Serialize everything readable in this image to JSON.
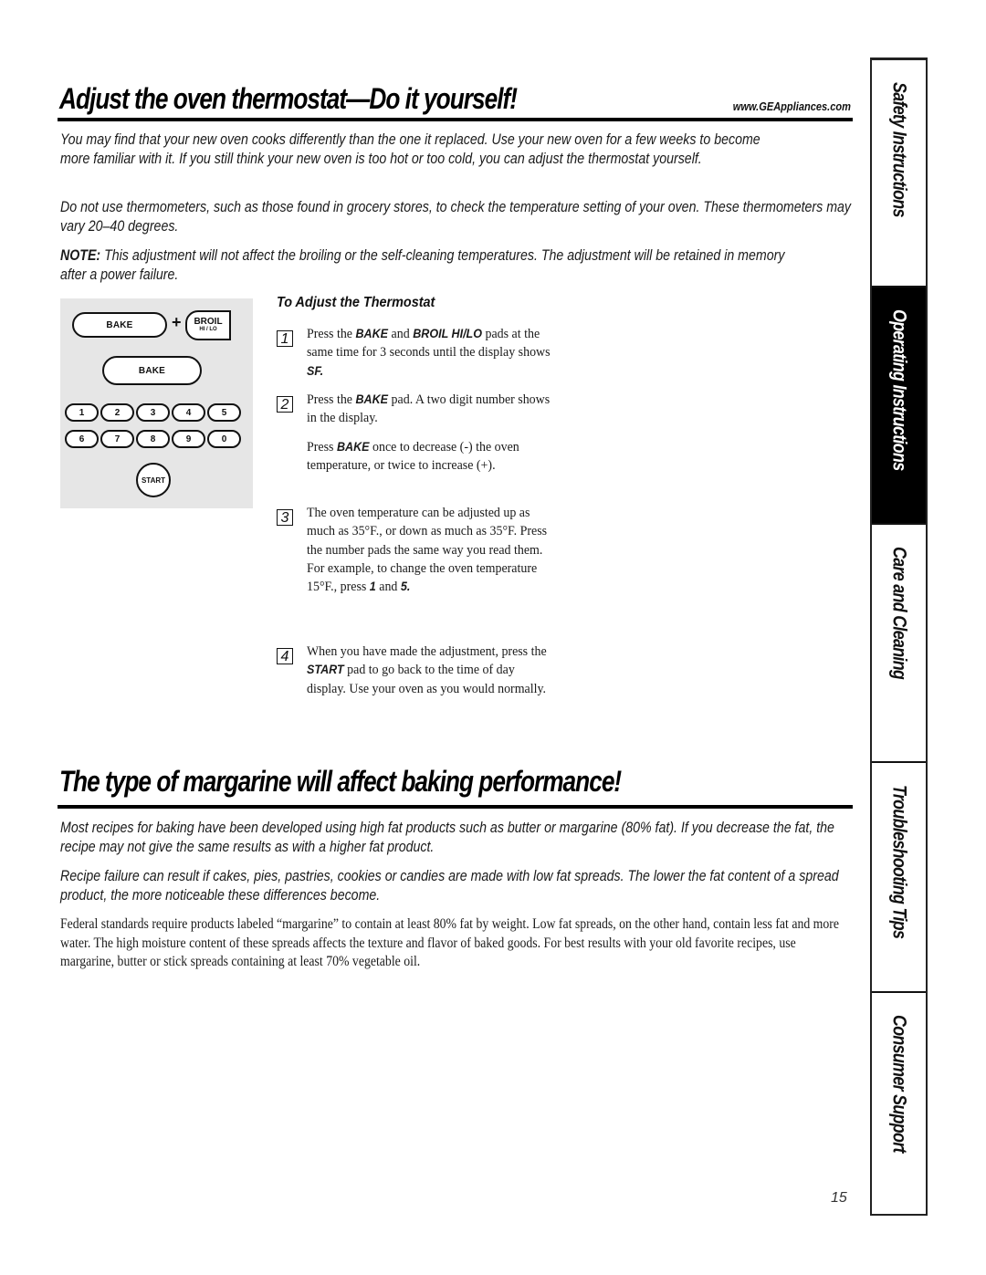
{
  "header": {
    "title": "Adjust the oven thermostat—Do it yourself!",
    "url": "www.GEAppliances.com"
  },
  "intro": {
    "p1": "You may find that your new oven cooks differently than the one it replaced. Use your new oven for a few weeks to become more familiar with it. If you still think your new oven is too hot or too cold, you can adjust the thermostat yourself.",
    "p2": "Do not use thermometers, such as those found in grocery stores, to check the temperature setting of your oven. These thermometers may vary 20–40 degrees.",
    "note_label": "NOTE:",
    "note_text": " This adjustment will not affect the broiling or the self-cleaning temperatures. The adjustment will be retained in memory after a power failure."
  },
  "keypad": {
    "bake_label": "BAKE",
    "plus": "+",
    "broil_label": "BROIL",
    "broil_sub": "HI / LO",
    "bake2_label": "BAKE",
    "numbers_row1": [
      "1",
      "2",
      "3",
      "4",
      "5"
    ],
    "numbers_row2": [
      "6",
      "7",
      "8",
      "9",
      "0"
    ],
    "start_label": "START"
  },
  "steps": {
    "heading": "To Adjust the Thermostat",
    "items": [
      {
        "num": "1",
        "parts": [
          "Press the ",
          "BAKE",
          " and ",
          "BROIL HI/LO",
          " pads at the same time for 3 seconds until the display shows ",
          "SF.",
          ""
        ]
      },
      {
        "num": "2",
        "parts": [
          "Press the ",
          "BAKE",
          " pad. A two digit number shows in the display."
        ]
      },
      {
        "num": "",
        "parts": [
          "Press ",
          "BAKE",
          " once to decrease (-) the oven temperature, or twice to increase (+)."
        ]
      },
      {
        "num": "3",
        "parts": [
          "The oven temperature can be adjusted up as much as 35°F., or down as much as 35°F. Press the number pads the same way you read them. For example, to change the oven temperature 15°F., press ",
          "1",
          " and ",
          "5.",
          ""
        ]
      },
      {
        "num": "4",
        "parts": [
          "When you have made the adjustment, press the ",
          "START",
          " pad to go back to the time of day display. Use your oven as you would normally."
        ]
      }
    ]
  },
  "margarine": {
    "title": "The type of margarine will affect baking performance!",
    "p1": "Most recipes for baking have been developed using high fat products such as butter or margarine (80% fat). If you decrease the fat, the recipe may not give the same results as with a higher fat product.",
    "p2": "Recipe failure can result if cakes, pies, pastries, cookies or candies are made with low fat spreads. The lower the fat content of a spread product, the more noticeable these differences become.",
    "p3": "Federal standards require products labeled “margarine” to contain at least 80% fat by weight. Low fat spreads, on the other hand, contain less fat and more water. The high moisture content of these spreads affects the texture and flavor of baked goods. For best results with your old favorite recipes, use margarine, butter or stick spreads containing at least 70% vegetable oil."
  },
  "side_tabs": [
    {
      "label": "Safety Instructions",
      "active": false
    },
    {
      "label": "Operating Instructions",
      "active": true
    },
    {
      "label": "Care and Cleaning",
      "active": false
    },
    {
      "label": "Troubleshooting Tips",
      "active": false
    },
    {
      "label": "Consumer Support",
      "active": false
    }
  ],
  "page_number": "15"
}
